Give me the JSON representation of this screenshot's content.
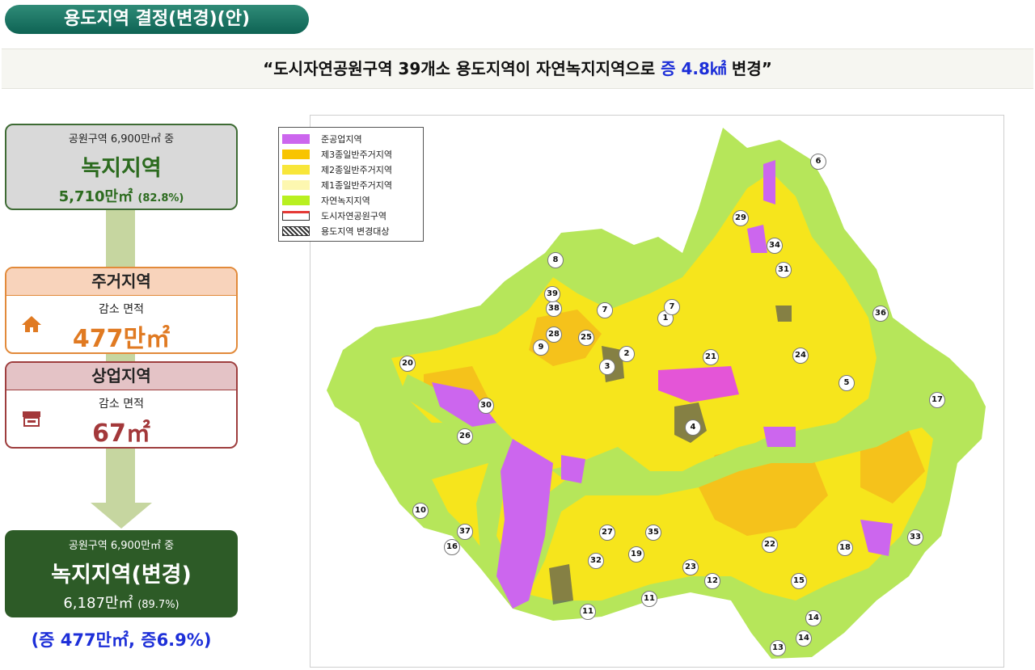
{
  "title": "용도지역 결정(변경)(안)",
  "headline": {
    "prefix": "“도시자연공원구역 39개소 용도지역이 자연녹지지역으로 ",
    "highlight": "증 4.8㎢",
    "suffix": " 변경”"
  },
  "flow": {
    "box1": {
      "small": "공원구역 6,900만㎡ 중",
      "big": "녹지지역",
      "value": "5,710만㎡",
      "pct": "(82.8%)"
    },
    "box2": {
      "header": "주거지역",
      "sub": "감소 면적",
      "amount": "477만㎡",
      "icon": "house-icon"
    },
    "box3": {
      "header": "상업지역",
      "sub": "감소 면적",
      "amount": "67㎡",
      "icon": "shop-icon"
    },
    "box4": {
      "small": "공원구역 6,900만㎡ 중",
      "big": "녹지지역(변경)",
      "value": "6,187만㎡",
      "pct": "(89.7%)"
    },
    "footer": "(증 477만㎡, 증6.9%)"
  },
  "colors": {
    "green_dark": "#2d5b27",
    "green_text": "#2c6b1f",
    "orange": "#e07a22",
    "maroon": "#a3383a",
    "blue": "#1d2fd8",
    "map_green": "#b6e65a",
    "map_yellow": "#f6e51c",
    "map_orange": "#f5c21b",
    "map_purple": "#cc66ee",
    "map_pink": "#e455d7"
  },
  "legend": [
    {
      "label": "준공업지역",
      "color": "#cc66ee"
    },
    {
      "label": "제3종일반주거지역",
      "color": "#f8c400"
    },
    {
      "label": "제2종일반주거지역",
      "color": "#f8e63a"
    },
    {
      "label": "제1종일반주거지역",
      "color": "#fdf7b0"
    },
    {
      "label": "자연녹지지역",
      "color": "#b8f020"
    },
    {
      "label": "도시자연공원구역",
      "color": "outline-red"
    },
    {
      "label": "용도지역 변경대상",
      "color": "hatch"
    }
  ],
  "map_labels": [
    "1",
    "2",
    "3",
    "4",
    "5",
    "6",
    "7",
    "7",
    "8",
    "9",
    "10",
    "11",
    "11",
    "12",
    "13",
    "14",
    "14",
    "15",
    "16",
    "17",
    "18",
    "19",
    "20",
    "21",
    "22",
    "23",
    "24",
    "25",
    "26",
    "27",
    "28",
    "29",
    "30",
    "31",
    "32",
    "33",
    "34",
    "35",
    "36",
    "37",
    "38",
    "39"
  ]
}
